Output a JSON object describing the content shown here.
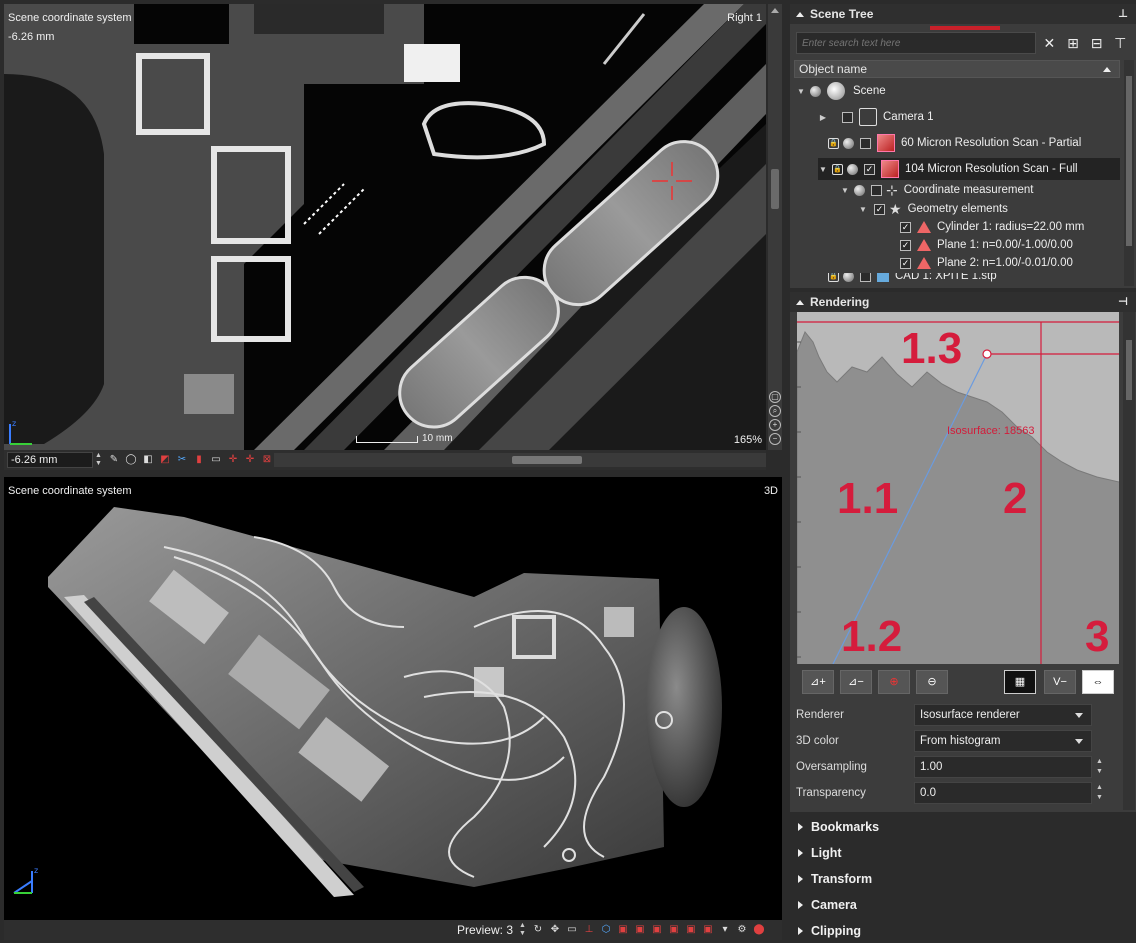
{
  "top_view": {
    "title": "Scene coordinate system",
    "view_name": "Right 1",
    "depth": "-6.26 mm",
    "scale_label": "10 mm",
    "zoom": "165%",
    "depth_field": "-6.26 mm"
  },
  "bottom_view": {
    "title": "Scene coordinate system",
    "view_name": "3D",
    "preview_label": "Preview: 3"
  },
  "scene_tree": {
    "title": "Scene Tree",
    "search_placeholder": "Enter search text here",
    "column_header": "Object name",
    "rows": [
      {
        "label": "Scene",
        "checked": false
      },
      {
        "label": "Camera 1",
        "checked": false
      },
      {
        "label": "60 Micron Resolution Scan - Partial",
        "checked": false
      },
      {
        "label": "104 Micron Resolution Scan - Full",
        "checked": true
      },
      {
        "label": "Coordinate measurement",
        "checked": false
      },
      {
        "label": "Geometry elements",
        "checked": true
      },
      {
        "label": "Cylinder 1: radius=22.00 mm",
        "checked": true
      },
      {
        "label": "Plane 1: n=0.00/-1.00/0.00",
        "checked": true
      },
      {
        "label": "Plane 2: n=1.00/-0.01/0.00",
        "checked": true
      },
      {
        "label": "CAD 1: XPITE 1.stp",
        "checked": false
      }
    ]
  },
  "rendering": {
    "title": "Rendering",
    "isosurface_label": "Isosurface: 18563",
    "markers": [
      "1.3",
      "1.1",
      "2",
      "1.2",
      "3"
    ],
    "properties": {
      "renderer_label": "Renderer",
      "renderer_value": "Isosurface renderer",
      "color_label": "3D color",
      "color_value": "From histogram",
      "oversampling_label": "Oversampling",
      "oversampling_value": "1.00",
      "transparency_label": "Transparency",
      "transparency_value": "0.0"
    }
  },
  "collapsed_panels": [
    "Bookmarks",
    "Light",
    "Transform",
    "Camera",
    "Clipping"
  ],
  "colors": {
    "accent_red": "#d51c3c",
    "curve_blue": "#6b9bdf",
    "panel_bg": "#3c3c3c"
  }
}
